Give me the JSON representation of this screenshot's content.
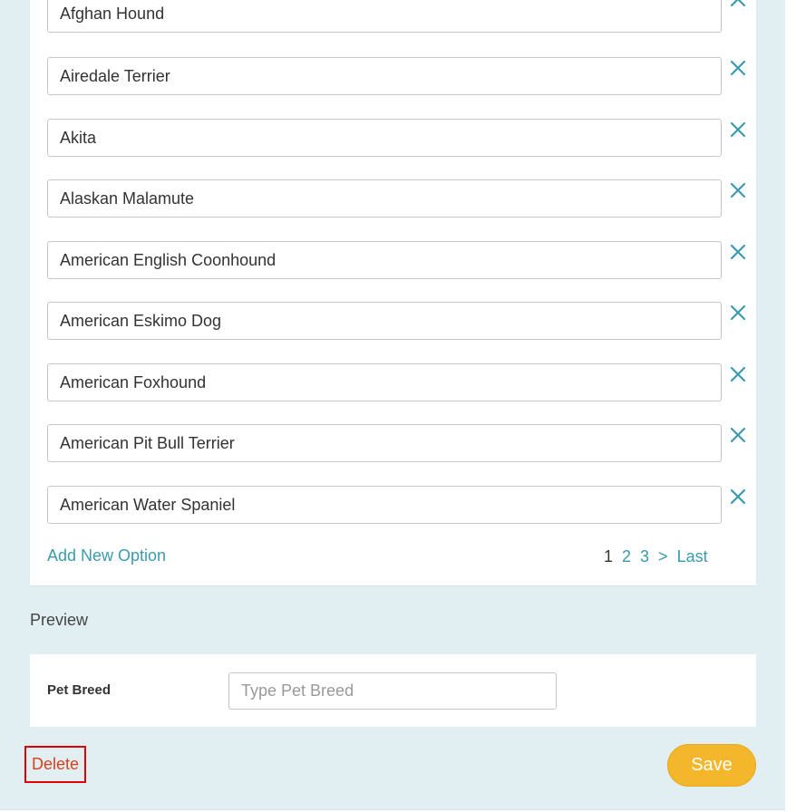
{
  "options": [
    {
      "value": "Afghan Hound"
    },
    {
      "value": "Airedale Terrier"
    },
    {
      "value": "Akita"
    },
    {
      "value": "Alaskan Malamute"
    },
    {
      "value": "American English Coonhound"
    },
    {
      "value": "American Eskimo Dog"
    },
    {
      "value": "American Foxhound"
    },
    {
      "value": "American Pit Bull Terrier"
    },
    {
      "value": "American Water Spaniel"
    }
  ],
  "add_option_label": "Add New Option",
  "pagination": {
    "current": "1",
    "pages": [
      "2",
      "3"
    ],
    "next": ">",
    "last": "Last"
  },
  "preview": {
    "heading": "Preview",
    "field_label": "Pet Breed",
    "placeholder": "Type Pet Breed"
  },
  "actions": {
    "delete_label": "Delete",
    "save_label": "Save"
  },
  "colors": {
    "accent": "#3a9bb0",
    "panel_bg": "#e1eff3",
    "save_bg": "#f4b72c",
    "delete_text": "#d9401c",
    "delete_border": "#e00000"
  }
}
